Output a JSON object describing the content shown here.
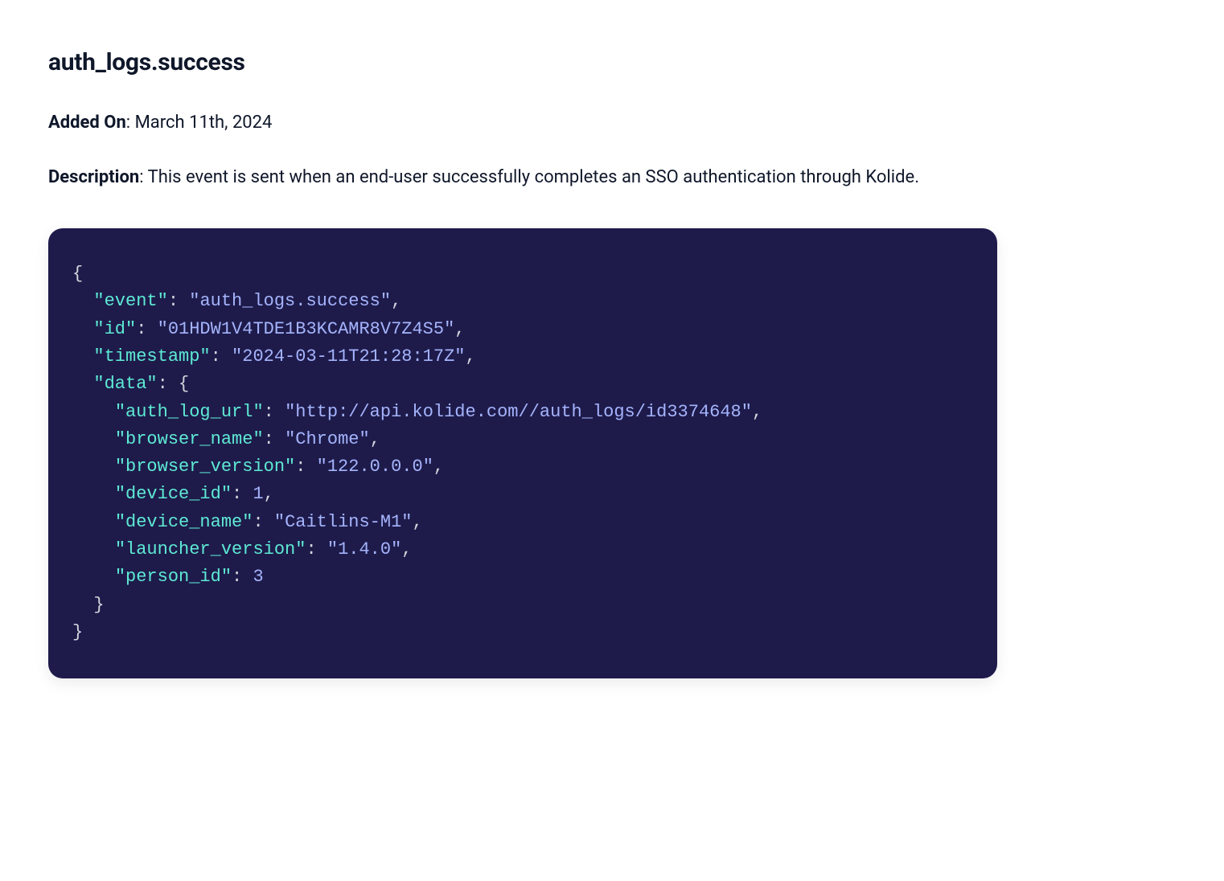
{
  "heading": "auth_logs.success",
  "added_on": {
    "label": "Added On",
    "value": "March 11th, 2024"
  },
  "description": {
    "label": "Description",
    "value": "This event is sent when an end-user successfully completes an SSO authentication through Kolide."
  },
  "code_sample": {
    "event": "auth_logs.success",
    "id": "01HDW1V4TDE1B3KCAMR8V7Z4S5",
    "timestamp": "2024-03-11T21:28:17Z",
    "data": {
      "auth_log_url": "http://api.kolide.com//auth_logs/id3374648",
      "browser_name": "Chrome",
      "browser_version": "122.0.0.0",
      "device_id": 1,
      "device_name": "Caitlins-M1",
      "launcher_version": "1.4.0",
      "person_id": 3
    }
  }
}
